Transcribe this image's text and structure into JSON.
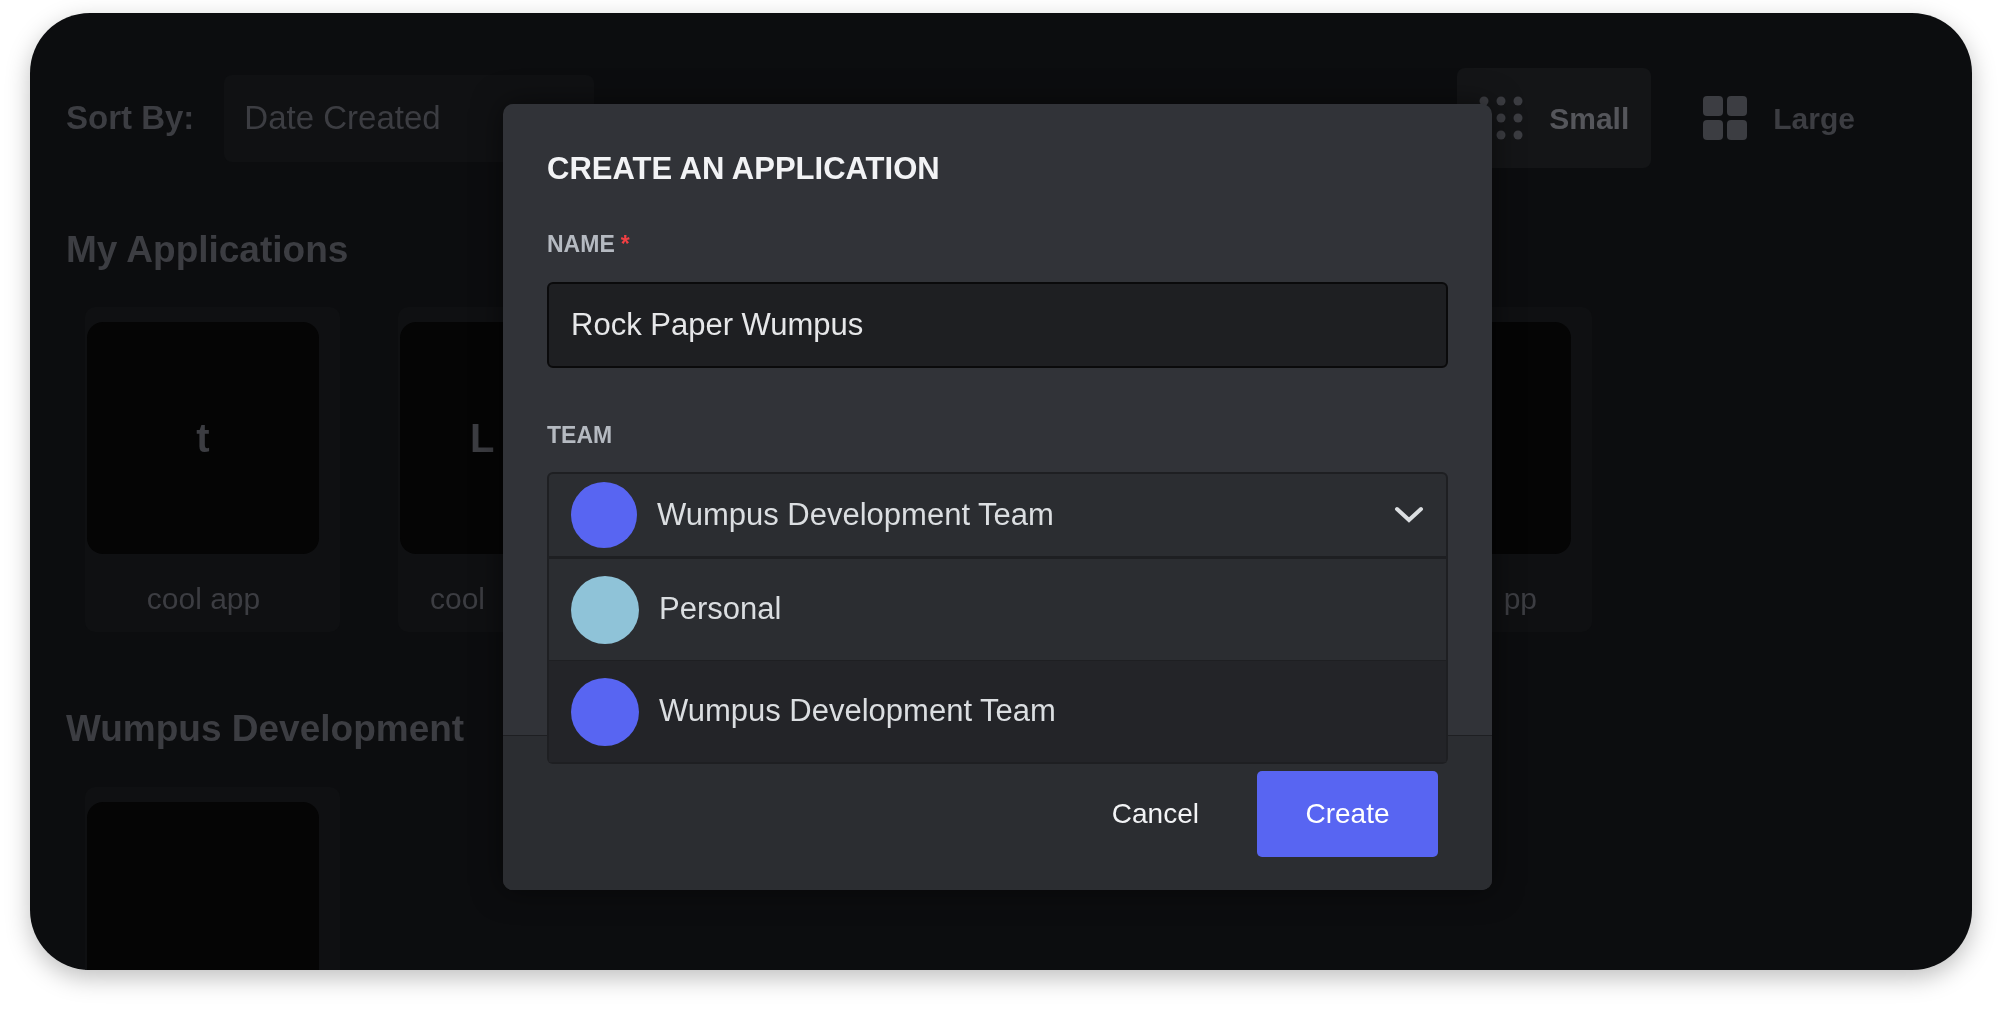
{
  "background": {
    "sort_label": "Sort By:",
    "sort_value": "Date Created",
    "view_toggles": [
      {
        "label": "Small",
        "selected": true
      },
      {
        "label": "Large",
        "selected": false
      }
    ],
    "sections": [
      {
        "title": "My Applications",
        "apps": [
          {
            "kind": "full",
            "icon_text": "t",
            "name": "cool app"
          },
          {
            "kind": "cut-right",
            "icon_text": "L",
            "name": "cool"
          },
          {
            "kind": "cut-left",
            "name": "pp"
          }
        ]
      },
      {
        "title": "Wumpus Development",
        "apps": [
          {
            "kind": "icon-only"
          }
        ]
      }
    ]
  },
  "dialog": {
    "title": "CREATE AN APPLICATION",
    "name_field": {
      "label": "NAME",
      "required_mark": "*",
      "value": "Rock Paper Wumpus"
    },
    "team_field": {
      "label": "TEAM",
      "value": "Wumpus Development Team",
      "expanded": true,
      "options": [
        {
          "label": "Personal",
          "kind": "person",
          "selected": false
        },
        {
          "label": "Wumpus Development Team",
          "kind": "team",
          "selected": true
        }
      ]
    },
    "buttons": [
      {
        "label": "Cancel",
        "kind": "link"
      },
      {
        "label": "Create",
        "kind": "primary"
      }
    ]
  }
}
